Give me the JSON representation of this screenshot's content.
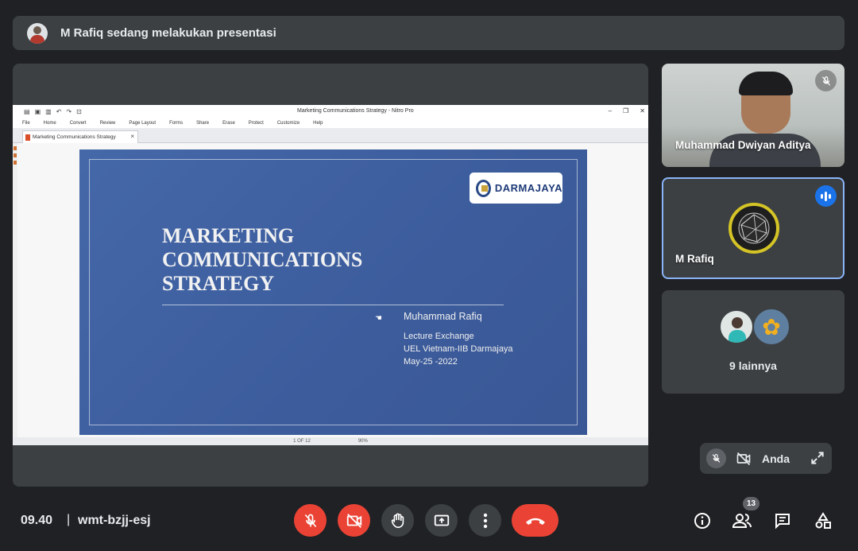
{
  "banner": {
    "presenting_text": "M Rafiq sedang melakukan presentasi"
  },
  "shared_window": {
    "window_title": "Marketing Communications Strategy - Nitro Pro",
    "menu": [
      "File",
      "Home",
      "Convert",
      "Review",
      "Page Layout",
      "Forms",
      "Share",
      "Erase",
      "Protect",
      "Customize",
      "Help"
    ],
    "document_tab": "Marketing Communications Strategy",
    "page_indicator": "1 OF 12",
    "zoom": "90%",
    "slide": {
      "logo_text": "DARMAJAYA",
      "title": "MARKETING\nCOMMUNICATIONS\nSTRATEGY",
      "presenter": "Muhammad Rafiq",
      "lines": [
        "Lecture Exchange",
        "UEL Vietnam-IIB Darmajaya",
        "May-25 -2022"
      ]
    }
  },
  "participants": {
    "tile1_name": "Muhammad Dwiyan Aditya",
    "tile2_name": "M Rafiq",
    "others_label": "9 lainnya"
  },
  "self_view": {
    "label": "Anda"
  },
  "bottom": {
    "time": "09.40",
    "separator": "|",
    "meeting_code": "wmt-bzjj-esj",
    "people_count": "13"
  },
  "colors": {
    "background": "#202124",
    "surface": "#3c4043",
    "danger": "#ea4335",
    "active_speaker": "#8ab4f8",
    "speaking_badge": "#1a73e8",
    "slide_blue": "#3f5fa0"
  },
  "icons": [
    "mic-off-icon",
    "camera-off-icon",
    "raise-hand-icon",
    "present-screen-icon",
    "more-options-icon",
    "call-end-icon",
    "info-icon",
    "people-icon",
    "chat-icon",
    "activities-icon",
    "expand-icon",
    "speaking-icon"
  ]
}
